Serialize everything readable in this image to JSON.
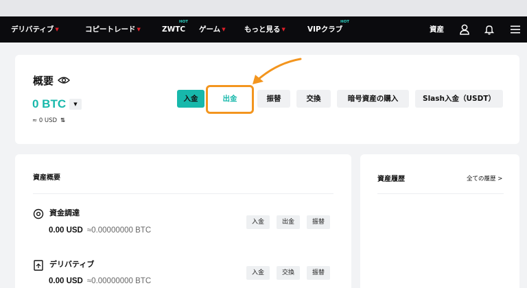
{
  "nav": {
    "items": [
      {
        "label": "デリバティブ",
        "dropdown": true
      },
      {
        "label": "コピートレード",
        "dropdown": true
      },
      {
        "label": "ZWTC",
        "hot": "HOT"
      },
      {
        "label": "ゲーム",
        "dropdown": true
      },
      {
        "label": "もっと見る",
        "dropdown": true
      },
      {
        "label": "VIPクラブ",
        "hot": "HOT"
      }
    ],
    "assets_label": "資産",
    "icons": [
      "user-icon",
      "bell-icon",
      "menu-icon"
    ]
  },
  "overview": {
    "title": "概要",
    "balance": "0 BTC",
    "balance_usd": "≈ 0 USD",
    "buttons": {
      "deposit": "入金",
      "withdraw": "出金",
      "transfer": "振替",
      "exchange": "交換",
      "buy_crypto": "暗号資産の購入",
      "slash": "Slash入金（USDT）"
    }
  },
  "asset_summary": {
    "title": "資産概要",
    "rows": [
      {
        "label": "資金調達",
        "usd": "0.00 USD",
        "btc": "≈0.00000000 BTC",
        "actions": [
          "入金",
          "出金",
          "振替"
        ]
      },
      {
        "label": "デリバティブ",
        "usd": "0.00 USD",
        "btc": "≈0.00000000 BTC",
        "actions": [
          "入金",
          "交換",
          "振替"
        ]
      }
    ]
  },
  "history": {
    "title": "資産履歴",
    "link": "全ての履歴 >"
  },
  "colors": {
    "accent": "#17b8ab",
    "highlight": "#f3951e",
    "dropdown_marker": "#e0202a"
  }
}
